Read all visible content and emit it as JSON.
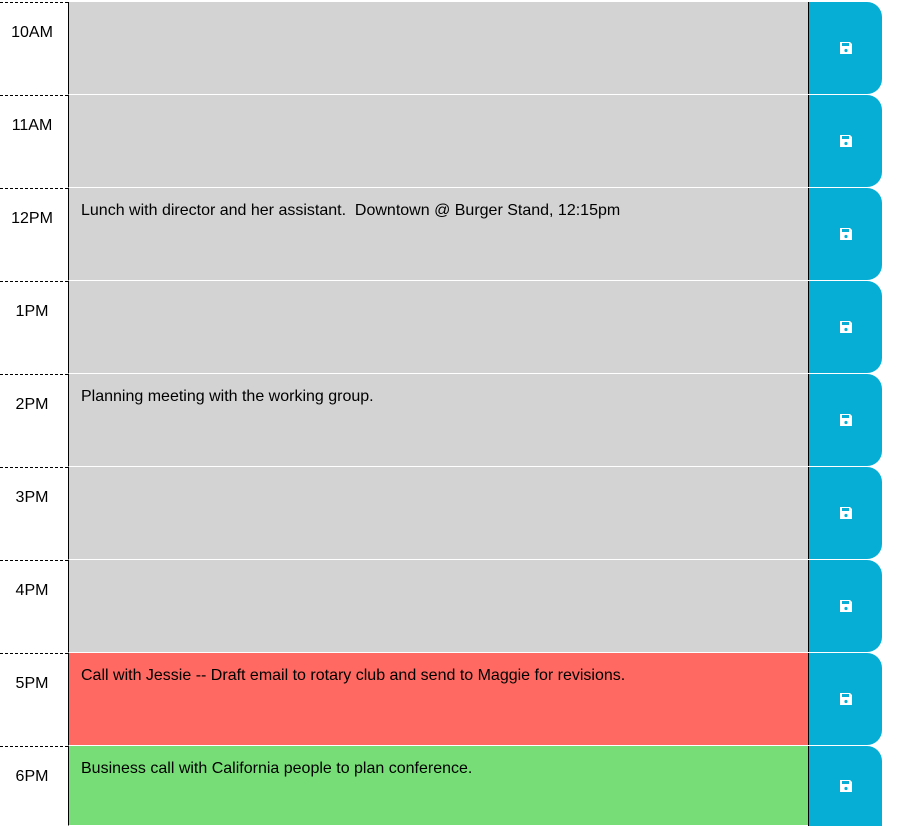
{
  "rows": [
    {
      "hour": "10AM",
      "text": "",
      "state": "past"
    },
    {
      "hour": "11AM",
      "text": "",
      "state": "past"
    },
    {
      "hour": "12PM",
      "text": "Lunch with director and her assistant.  Downtown @ Burger Stand, 12:15pm",
      "state": "past"
    },
    {
      "hour": "1PM",
      "text": "",
      "state": "past"
    },
    {
      "hour": "2PM",
      "text": "Planning meeting with the working group.",
      "state": "past"
    },
    {
      "hour": "3PM",
      "text": "",
      "state": "past"
    },
    {
      "hour": "4PM",
      "text": "",
      "state": "past"
    },
    {
      "hour": "5PM",
      "text": "Call with Jessie -- Draft email to rotary club and send to Maggie for revisions.",
      "state": "present"
    },
    {
      "hour": "6PM",
      "text": "Business call with California people to plan conference.",
      "state": "future"
    }
  ],
  "save_icon": "floppy-disk-icon",
  "colors": {
    "past": "#d3d3d3",
    "present": "#ff6961",
    "future": "#77dd77",
    "save_button": "#06aed5"
  }
}
